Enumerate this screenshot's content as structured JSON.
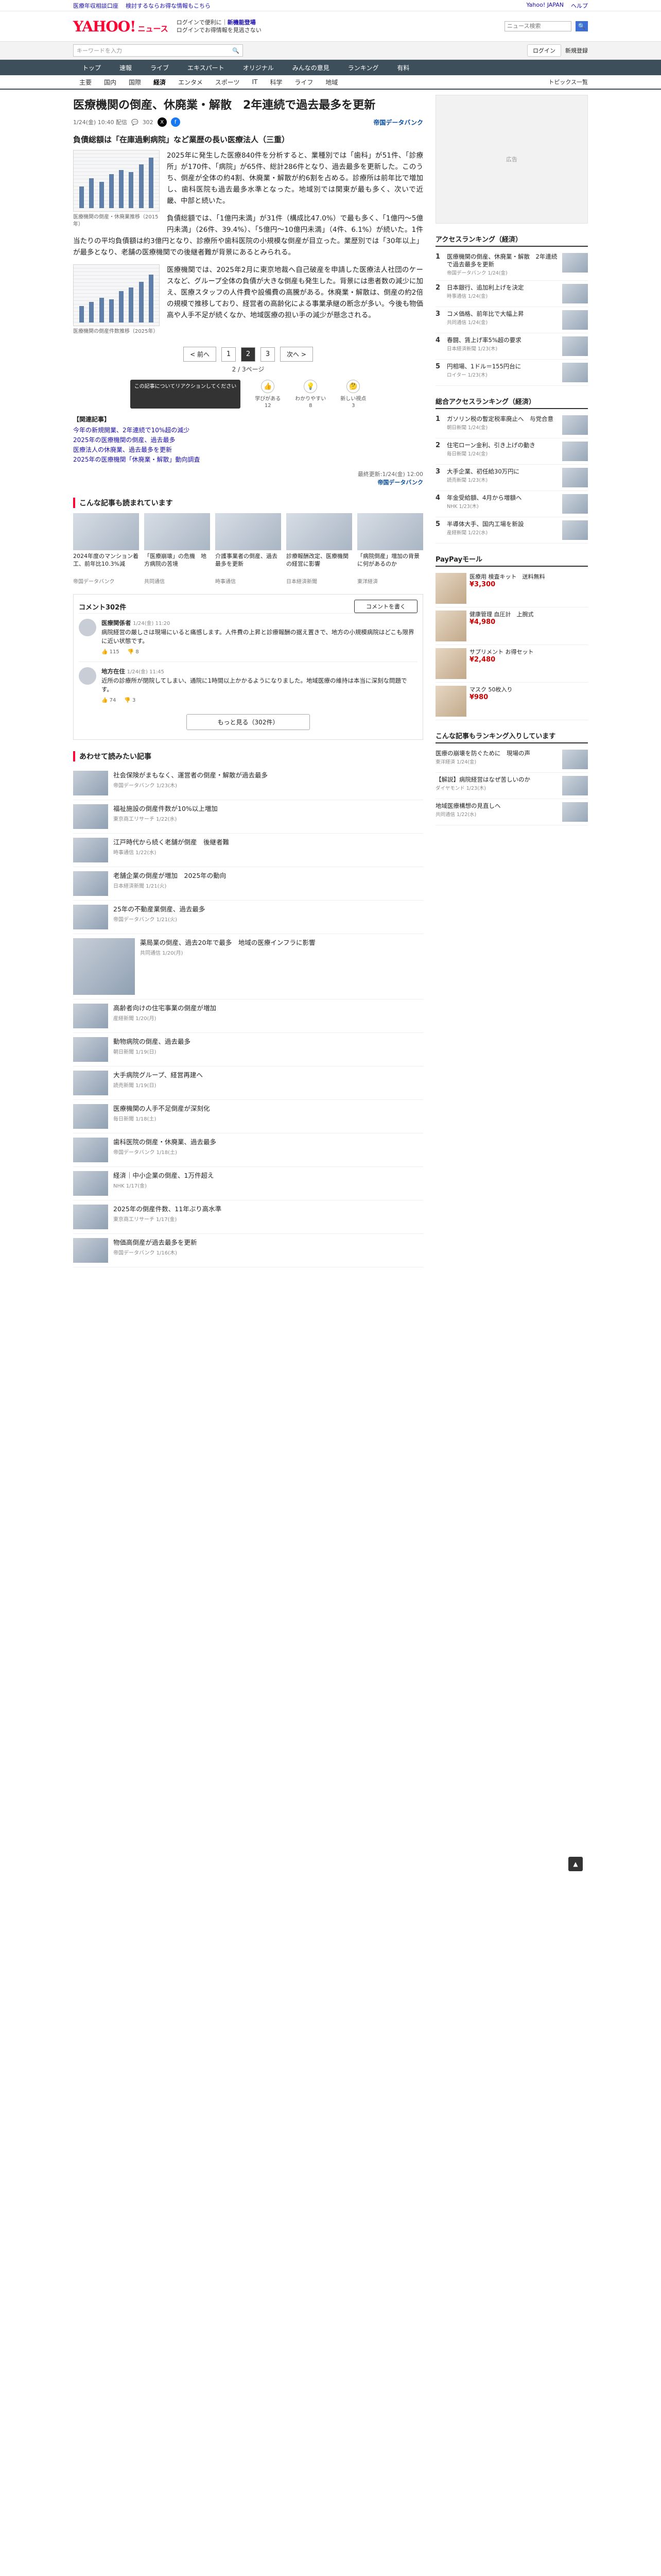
{
  "topbar": {
    "left": [
      "医療年収相談口座",
      "検討するならお得な情報もこちら"
    ],
    "right": [
      "Yahoo! JAPAN",
      "ヘルプ"
    ]
  },
  "header": {
    "logo": "YAHOO!",
    "logo_sub": "ニュース",
    "promo1": "ログインで便利に",
    "promo1b": "新機能登場",
    "promo2": "ログインでお得情報を見逃さない",
    "search_placeholder": "ニュース検索",
    "search_button_label": "🔍"
  },
  "searchrow": {
    "placeholder": "キーワードを入力",
    "login": "ログイン",
    "signup": "新規登録"
  },
  "nav_main": [
    {
      "label": "トップ"
    },
    {
      "label": "速報"
    },
    {
      "label": "ライブ"
    },
    {
      "label": "エキスパート"
    },
    {
      "label": "オリジナル"
    },
    {
      "label": "みんなの意見"
    },
    {
      "label": "ランキング"
    },
    {
      "label": "有料"
    }
  ],
  "nav_sub": [
    {
      "label": "主要"
    },
    {
      "label": "国内"
    },
    {
      "label": "国際"
    },
    {
      "label": "経済"
    },
    {
      "label": "エンタメ"
    },
    {
      "label": "スポーツ"
    },
    {
      "label": "IT"
    },
    {
      "label": "科学"
    },
    {
      "label": "ライフ"
    },
    {
      "label": "地域"
    }
  ],
  "nav_sub_more": "トピックス一覧",
  "article": {
    "title": "医療機関の倒産、休廃業・解散　2年連続で過去最多を更新",
    "date": "1/24(金) 10:40 配信",
    "comments": "302",
    "source": "帝国データバンク",
    "sec1": "負債総額は「在庫過剰病院」など業歴の長い医療法人（三重）",
    "fig1_caption": "医療機関の倒産・休廃業推移（2015年）",
    "p1": "2025年に発生した医療840件を分析すると、業種別では「歯科」が51件、「診療所」が170件、「病院」が65件、総計286件となり、過去最多を更新した。このうち、倒産が全体の約4割、休廃業・解散が約6割を占める。診療所は前年比で増加し、歯科医院も過去最多水準となった。地域別では関東が最も多く、次いで近畿、中部と続いた。",
    "p2": "負債総額では、「1億円未満」が31件（構成比47.0%）で最も多く、「1億円～5億円未満」（26件、39.4%）、「5億円～10億円未満」（4件、6.1%）が続いた。1件当たりの平均負債額は約3億円となり、診療所や歯科医院の小規模な倒産が目立った。業歴別では「30年以上」が最多となり、老舗の医療機関での後継者難が背景にあるとみられる。",
    "fig2_caption": "医療機関の倒産件数推移（2025年）",
    "p3": "医療機関では、2025年2月に東京地裁へ自己破産を申請した医療法人社団のケースなど、グループ全体の負債が大きな倒産も発生した。背景には患者数の減少に加え、医療スタッフの人件費や設備費の高騰がある。休廃業・解散は、倒産の約2倍の規模で推移しており、経営者の高齢化による事業承継の断念が多い。今後も物価高や人手不足が続くなか、地域医療の担い手の減少が懸念される。",
    "related_head": "【関連記事】",
    "related": [
      "今年の新規開業、2年連続で10%超の減少",
      "2025年の医療機関の倒産、過去最多",
      "医療法人の休廃業、過去最多を更新",
      "2025年の医療機関「休廃業・解散」動向調査"
    ],
    "pub_date": "最終更新:1/24(金) 12:00",
    "pub_source": "帝国データバンク",
    "page_prev": "< 前へ",
    "page_next": "次へ >",
    "pages": [
      "1",
      "2",
      "3"
    ],
    "page_count": "2 / 3ページ",
    "reactions": [
      {
        "icon": "👍",
        "label": "学びがある",
        "count": "12"
      },
      {
        "icon": "💡",
        "label": "わかりやすい",
        "count": "8"
      },
      {
        "icon": "🤔",
        "label": "新しい視点",
        "count": "3"
      }
    ],
    "reaction_tip": "この記事についてリアクションしてください"
  },
  "recommend": {
    "head": "こんな記事も読まれています",
    "cards": [
      {
        "title": "2024年度のマンション着工、前年比10.3%減",
        "src": "帝国データバンク"
      },
      {
        "title": "「医療崩壊」の危機　地方病院の苦境",
        "src": "共同通信"
      },
      {
        "title": "介護事業者の倒産、過去最多を更新",
        "src": "時事通信"
      },
      {
        "title": "診療報酬改定、医療機関の経営に影響",
        "src": "日本経済新聞"
      },
      {
        "title": "「病院倒産」増加の背景に何があるのか",
        "src": "東洋経済"
      }
    ]
  },
  "comments": {
    "head": "コメント302件",
    "write": "コメントを書く",
    "items": [
      {
        "name": "医療関係者",
        "time": "1/24(金) 11:20",
        "body": "病院経営の厳しさは現場にいると痛感します。人件費の上昇と診療報酬の据え置きで、地方の小規模病院はどこも限界に近い状態です。",
        "good": "115",
        "bad": "8"
      },
      {
        "name": "地方在住",
        "time": "1/24(金) 11:45",
        "body": "近所の診療所が閉院してしまい、通院に1時間以上かかるようになりました。地域医療の維持は本当に深刻な問題です。",
        "good": "74",
        "bad": "3"
      }
    ],
    "more": "もっと見る（302件）"
  },
  "also": {
    "head": "あわせて読みたい記事",
    "items": [
      {
        "title": "社会保険がまもなく、運営者の倒産・解散が過去最多",
        "src": "帝国データバンク 1/23(木)"
      },
      {
        "title": "福祉施設の倒産件数が10%以上増加",
        "src": "東京商工リサーチ 1/22(水)"
      },
      {
        "title": "江戸時代から続く老舗が倒産　後継者難",
        "src": "時事通信 1/22(水)"
      },
      {
        "title": "老舗企業の倒産が増加　2025年の動向",
        "src": "日本経済新聞 1/21(火)"
      },
      {
        "title": "25年の不動産業倒産、過去最多",
        "src": "帝国データバンク 1/21(火)"
      },
      {
        "title": "薬局業の倒産、過去20年で最多　地域の医療インフラに影響",
        "src": "共同通信 1/20(月)"
      },
      {
        "title": "高齢者向けの住宅事業の倒産が増加",
        "src": "産経新聞 1/20(月)"
      },
      {
        "title": "動物病院の倒産、過去最多",
        "src": "朝日新聞 1/19(日)"
      },
      {
        "title": "大手病院グループ、経営再建へ",
        "src": "読売新聞 1/19(日)"
      },
      {
        "title": "医療機関の人手不足倒産が深刻化",
        "src": "毎日新聞 1/18(土)"
      },
      {
        "title": "歯科医院の倒産・休廃業、過去最多",
        "src": "帝国データバンク 1/18(土)"
      },
      {
        "title": "経済｜中小企業の倒産、1万件超え",
        "src": "NHK 1/17(金)"
      },
      {
        "title": "2025年の倒産件数、11年ぶり高水準",
        "src": "東京商工リサーチ 1/17(金)"
      },
      {
        "title": "物価高倒産が過去最多を更新",
        "src": "帝国データバンク 1/16(木)"
      }
    ]
  },
  "side": {
    "rank_head": "アクセスランキング（経済）",
    "rank": [
      {
        "n": "1",
        "title": "医療機関の倒産、休廃業・解散　2年連続で過去最多を更新",
        "src": "帝国データバンク 1/24(金)"
      },
      {
        "n": "2",
        "title": "日本銀行、追加利上げを決定",
        "src": "時事通信 1/24(金)"
      },
      {
        "n": "3",
        "title": "コメ価格、前年比で大幅上昇",
        "src": "共同通信 1/24(金)"
      },
      {
        "n": "4",
        "title": "春闘、賃上げ率5%超の要求",
        "src": "日本経済新聞 1/23(木)"
      },
      {
        "n": "5",
        "title": "円相場、1ドル＝155円台に",
        "src": "ロイター 1/23(木)"
      }
    ],
    "ad_label": "広告",
    "rank2_head": "総合アクセスランキング（経済）",
    "rank2": [
      {
        "n": "1",
        "title": "ガソリン税の暫定税率廃止へ　与党合意",
        "src": "朝日新聞 1/24(金)"
      },
      {
        "n": "2",
        "title": "住宅ローン金利、引き上げの動き",
        "src": "毎日新聞 1/24(金)"
      },
      {
        "n": "3",
        "title": "大手企業、初任給30万円に",
        "src": "読売新聞 1/23(木)"
      },
      {
        "n": "4",
        "title": "年金受給額、4月から増額へ",
        "src": "NHK 1/23(木)"
      },
      {
        "n": "5",
        "title": "半導体大手、国内工場を新設",
        "src": "産経新聞 1/22(水)"
      }
    ],
    "shop_head": "PayPayモール",
    "shop": [
      {
        "title": "医療用 検査キット　送料無料",
        "price": "¥3,300"
      },
      {
        "title": "健康管理 血圧計　上腕式",
        "price": "¥4,980"
      },
      {
        "title": "サプリメント お得セット",
        "price": "¥2,480"
      },
      {
        "title": "マスク 50枚入り",
        "price": "¥980"
      }
    ],
    "rank3_head": "こんな記事もランキング入りしています",
    "rank3": [
      {
        "title": "医療の崩壊を防ぐために　現場の声",
        "src": "東洋経済 1/24(金)"
      },
      {
        "title": "【解説】病院経営はなぜ苦しいのか",
        "src": "ダイヤモンド 1/23(木)"
      },
      {
        "title": "地域医療構想の見直しへ",
        "src": "共同通信 1/22(水)"
      }
    ]
  },
  "totop": "▲"
}
